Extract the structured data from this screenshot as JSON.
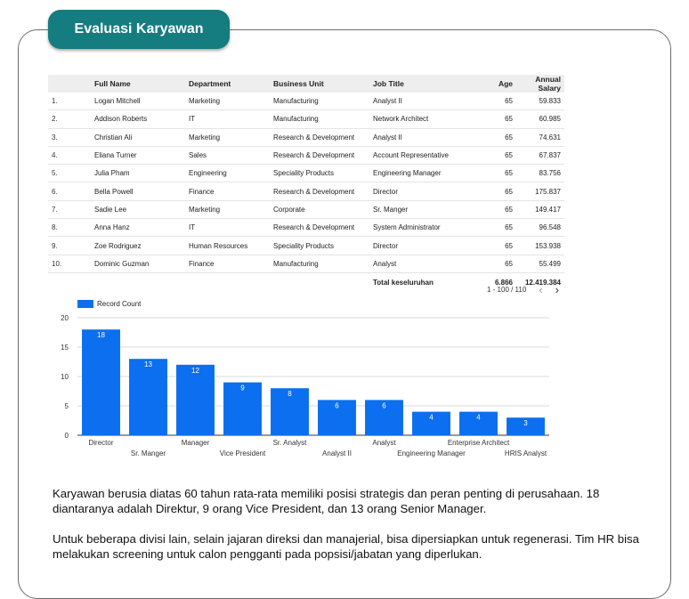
{
  "header": {
    "title": "Evaluasi Karyawan"
  },
  "table": {
    "columns": [
      "Full Name",
      "Department",
      "Business Unit",
      "Job Title",
      "Age",
      "Annual Salary"
    ],
    "rows": [
      {
        "idx": "1.",
        "name": "Logan Mitchell",
        "department": "Marketing",
        "unit": "Manufacturing",
        "title": "Analyst II",
        "age": "65",
        "salary": "59.833"
      },
      {
        "idx": "2.",
        "name": "Addison Roberts",
        "department": "IT",
        "unit": "Manufacturing",
        "title": "Network Architect",
        "age": "65",
        "salary": "60.985"
      },
      {
        "idx": "3.",
        "name": "Christian Ali",
        "department": "Marketing",
        "unit": "Research & Development",
        "title": "Analyst II",
        "age": "65",
        "salary": "74.631"
      },
      {
        "idx": "4.",
        "name": "Eliana Turner",
        "department": "Sales",
        "unit": "Research & Development",
        "title": "Account Representative",
        "age": "65",
        "salary": "67.837"
      },
      {
        "idx": "5.",
        "name": "Julia Pham",
        "department": "Engineering",
        "unit": "Speciality Products",
        "title": "Engineering Manager",
        "age": "65",
        "salary": "83.756"
      },
      {
        "idx": "6.",
        "name": "Bella Powell",
        "department": "Finance",
        "unit": "Research & Development",
        "title": "Director",
        "age": "65",
        "salary": "175.837"
      },
      {
        "idx": "7.",
        "name": "Sadie Lee",
        "department": "Marketing",
        "unit": "Corporate",
        "title": "Sr. Manger",
        "age": "65",
        "salary": "149.417"
      },
      {
        "idx": "8.",
        "name": "Anna Hanz",
        "department": "IT",
        "unit": "Research & Development",
        "title": "System Administrator",
        "age": "65",
        "salary": "96.548"
      },
      {
        "idx": "9.",
        "name": "Zoe Rodriguez",
        "department": "Human Resources",
        "unit": "Speciality Products",
        "title": "Director",
        "age": "65",
        "salary": "153.938"
      },
      {
        "idx": "10.",
        "name": "Dominic Guzman",
        "department": "Finance",
        "unit": "Manufacturing",
        "title": "Analyst",
        "age": "65",
        "salary": "55.499"
      }
    ],
    "total": {
      "label": "Total keseluruhan",
      "age": "6.866",
      "salary": "12.419.384"
    }
  },
  "pager": {
    "range": "1 - 100 / 110",
    "prev_icon": "chevron-left-icon",
    "next_icon": "chevron-right-icon"
  },
  "chart_data": {
    "type": "bar",
    "legend": "Record Count",
    "color": "#0b6ff0",
    "categories": [
      "Director",
      "Sr. Manger",
      "Manager",
      "Vice President",
      "Sr. Analyst",
      "Analyst II",
      "Analyst",
      "Engineering Manager",
      "Enterprise Architect",
      "HRIS Analyst"
    ],
    "values": [
      18,
      13,
      12,
      9,
      8,
      6,
      6,
      4,
      4,
      3
    ],
    "yticks": [
      0,
      5,
      10,
      15,
      20
    ],
    "ylim": [
      0,
      20
    ],
    "grid": true,
    "legend_position": "top-left"
  },
  "description": {
    "p1": "Karyawan berusia diatas 60 tahun rata-rata memiliki posisi strategis dan peran penting di perusahaan. 18 diantaranya adalah Direktur, 9 orang Vice President, dan 13 orang Senior Manager.",
    "p2": "Untuk beberapa divisi lain, selain jajaran direksi dan manajerial, bisa dipersiapkan untuk regenerasi. Tim HR bisa melakukan screening untuk calon pengganti pada popsisi/jabatan yang diperlukan."
  }
}
